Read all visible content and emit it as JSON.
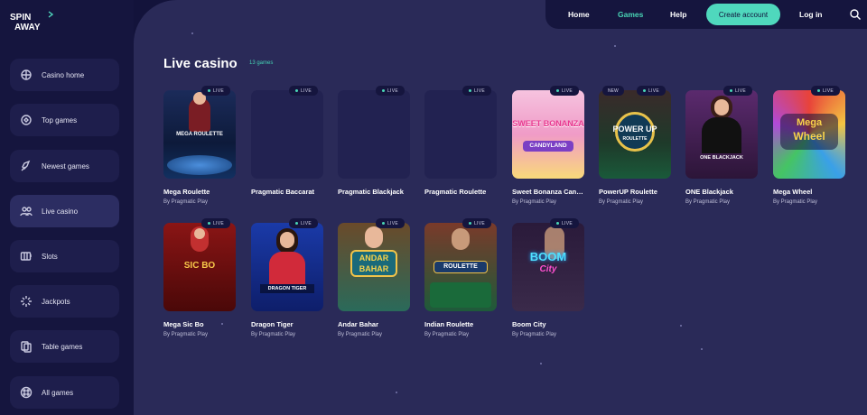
{
  "brand": {
    "name": "SPINAWAY"
  },
  "header": {
    "nav": [
      {
        "label": "Home"
      },
      {
        "label": "Games"
      },
      {
        "label": "Help"
      }
    ],
    "create_account": "Create account",
    "login": "Log in",
    "search_icon": "search-icon"
  },
  "sidebar": {
    "items": [
      {
        "label": "Casino home",
        "icon": "home-icon"
      },
      {
        "label": "Top games",
        "icon": "trophy-icon"
      },
      {
        "label": "Newest games",
        "icon": "rocket-icon"
      },
      {
        "label": "Live casino",
        "icon": "people-icon"
      },
      {
        "label": "Slots",
        "icon": "slots-icon"
      },
      {
        "label": "Jackpots",
        "icon": "jackpot-icon"
      },
      {
        "label": "Table games",
        "icon": "cards-icon"
      },
      {
        "label": "All games",
        "icon": "grid-icon"
      }
    ]
  },
  "main": {
    "title": "Live casino",
    "count": "13 games",
    "live_label": "LIVE",
    "new_label": "NEW",
    "games": [
      {
        "title": "Mega Roulette",
        "provider": "By Pragmatic Play",
        "art_text": "MEGA ROULETTE"
      },
      {
        "title": "Pragmatic Baccarat",
        "provider": "",
        "art_text": ""
      },
      {
        "title": "Pragmatic Blackjack",
        "provider": "",
        "art_text": ""
      },
      {
        "title": "Pragmatic Roulette",
        "provider": "",
        "art_text": ""
      },
      {
        "title": "Sweet Bonanza CandyLand",
        "provider": "By Pragmatic Play",
        "art_text": "SWEET BONANZA",
        "art_text2": "CANDYLAND"
      },
      {
        "title": "PowerUP Roulette",
        "provider": "By Pragmatic Play",
        "art_text": "POWER UP",
        "art_text2": "ROULETTE"
      },
      {
        "title": "ONE Blackjack",
        "provider": "By Pragmatic Play",
        "art_text": "ONE BLACKJACK"
      },
      {
        "title": "Mega Wheel",
        "provider": "By Pragmatic Play",
        "art_text": "Mega",
        "art_text2": "Wheel"
      },
      {
        "title": "Mega Sic Bo",
        "provider": "By Pragmatic Play",
        "art_text": "SIC BO"
      },
      {
        "title": "Dragon Tiger",
        "provider": "By Pragmatic Play",
        "art_text": "DRAGON TIGER"
      },
      {
        "title": "Andar Bahar",
        "provider": "By Pragmatic Play",
        "art_text": "ANDAR",
        "art_text2": "BAHAR"
      },
      {
        "title": "Indian Roulette",
        "provider": "By Pragmatic Play",
        "art_text": "ROULETTE"
      },
      {
        "title": "Boom City",
        "provider": "By Pragmatic Play",
        "art_text": "BOOM",
        "art_text2": "City"
      }
    ]
  }
}
